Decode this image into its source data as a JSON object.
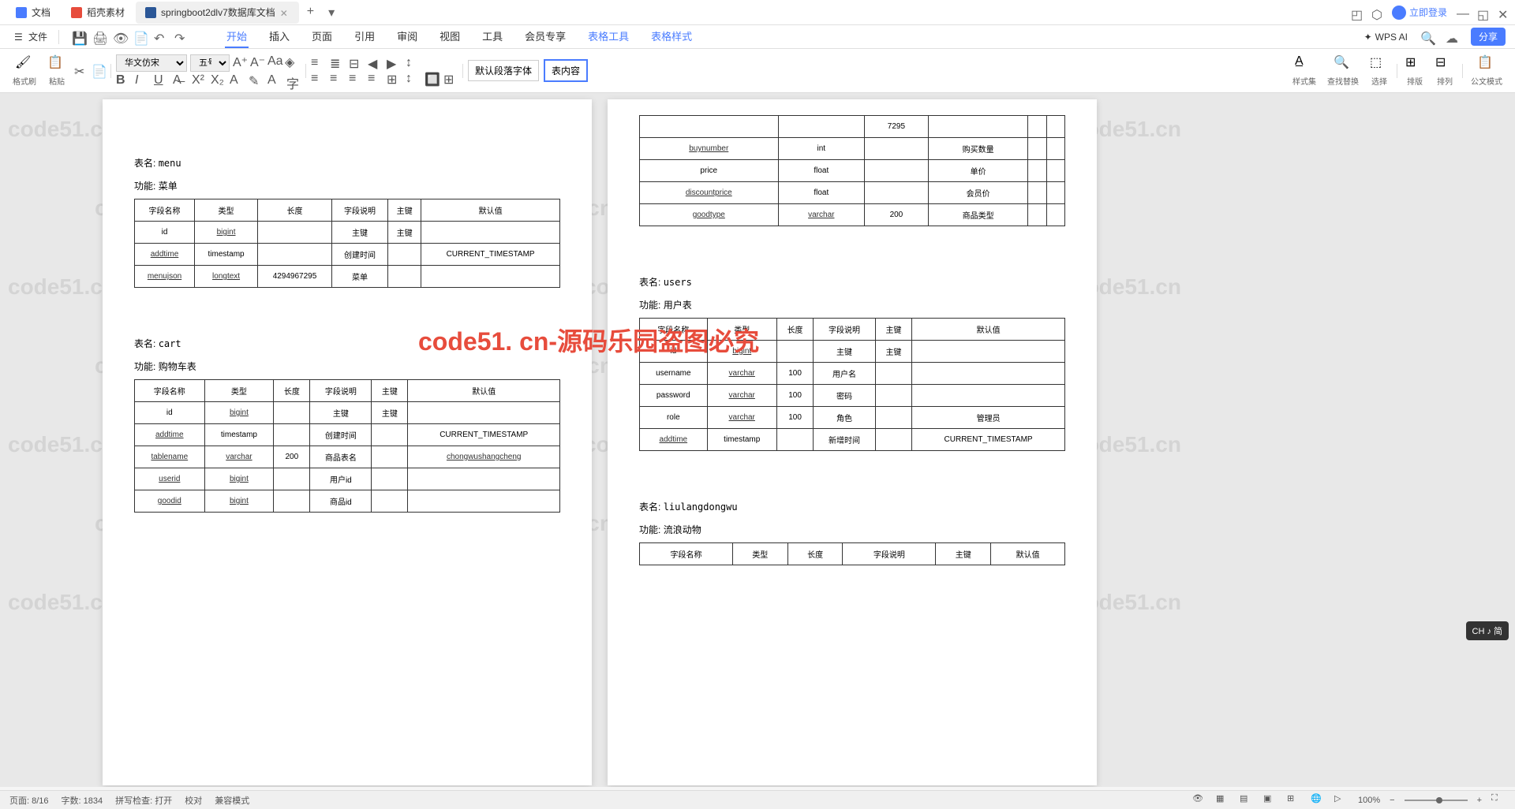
{
  "titlebar": {
    "tabs": [
      {
        "icon": "doc",
        "label": "文档"
      },
      {
        "icon": "red",
        "label": "稻壳素材"
      },
      {
        "icon": "word",
        "label": "springboot2dlv7数据库文档"
      }
    ],
    "login": "立即登录"
  },
  "menubar": {
    "file": "文件",
    "ribbon_tabs": [
      "开始",
      "插入",
      "页面",
      "引用",
      "审阅",
      "视图",
      "工具",
      "会员专享"
    ],
    "table_tabs": [
      "表格工具",
      "表格样式"
    ],
    "ai": "WPS AI",
    "share": "分享"
  },
  "ribbon": {
    "format_painter": "格式刷",
    "paste": "粘贴",
    "font": "华文仿宋",
    "size": "五号",
    "para_style_default": "默认段落字体",
    "para_style_content": "表内容",
    "styles": "样式集",
    "find_replace": "查找替换",
    "select": "选择",
    "arrange": "排版",
    "align": "排列",
    "doc_mode": "公文模式"
  },
  "doc": {
    "page_left": {
      "menu": {
        "title_label": "表名:",
        "title": "menu",
        "func_label": "功能:",
        "func": "菜单",
        "headers": [
          "字段名称",
          "类型",
          "长度",
          "字段说明",
          "主键",
          "默认值"
        ],
        "rows": [
          [
            "id",
            "bigint",
            "",
            "主键",
            "主键",
            ""
          ],
          [
            "addtime",
            "timestamp",
            "",
            "创建时间",
            "",
            "CURRENT_TIMESTAMP"
          ],
          [
            "menujson",
            "longtext",
            "4294967295",
            "菜单",
            "",
            ""
          ]
        ]
      },
      "cart": {
        "title_label": "表名:",
        "title": "cart",
        "func_label": "功能:",
        "func": "购物车表",
        "headers": [
          "字段名称",
          "类型",
          "长度",
          "字段说明",
          "主键",
          "默认值"
        ],
        "rows": [
          [
            "id",
            "bigint",
            "",
            "主键",
            "主键",
            ""
          ],
          [
            "addtime",
            "timestamp",
            "",
            "创建时间",
            "",
            "CURRENT_TIMESTAMP"
          ],
          [
            "tablename",
            "varchar",
            "200",
            "商品表名",
            "",
            "chongwushangcheng"
          ],
          [
            "userid",
            "bigint",
            "",
            "用户id",
            "",
            ""
          ],
          [
            "goodid",
            "bigint",
            "",
            "商品id",
            "",
            ""
          ]
        ]
      }
    },
    "page_right": {
      "top_rows": [
        [
          "",
          "",
          "7295",
          "",
          "",
          ""
        ],
        [
          "buynumber",
          "int",
          "",
          "购买数量",
          "",
          ""
        ],
        [
          "price",
          "float",
          "",
          "单价",
          "",
          ""
        ],
        [
          "discountprice",
          "float",
          "",
          "会员价",
          "",
          ""
        ],
        [
          "goodtype",
          "varchar",
          "200",
          "商品类型",
          "",
          ""
        ]
      ],
      "users": {
        "title_label": "表名:",
        "title": "users",
        "func_label": "功能:",
        "func": "用户表",
        "headers": [
          "字段名称",
          "类型",
          "长度",
          "字段说明",
          "主键",
          "默认值"
        ],
        "rows": [
          [
            "id",
            "bigint",
            "",
            "主键",
            "主键",
            ""
          ],
          [
            "username",
            "varchar",
            "100",
            "用户名",
            "",
            ""
          ],
          [
            "password",
            "varchar",
            "100",
            "密码",
            "",
            ""
          ],
          [
            "role",
            "varchar",
            "100",
            "角色",
            "",
            "管理员"
          ],
          [
            "addtime",
            "timestamp",
            "",
            "新增时间",
            "",
            "CURRENT_TIMESTAMP"
          ]
        ]
      },
      "liulang": {
        "title_label": "表名:",
        "title": "liulangdongwu",
        "func_label": "功能:",
        "func": "流浪动物",
        "headers": [
          "字段名称",
          "类型",
          "长度",
          "字段说明",
          "主键",
          "默认值"
        ]
      }
    }
  },
  "statusbar": {
    "page": "页面: 8/16",
    "words": "字数: 1834",
    "spell": "拼写检查: 打开",
    "proof": "校对",
    "compat": "兼容模式",
    "zoom": "100%"
  },
  "watermark_text": "code51.cn",
  "watermark_red": "code51. cn-源码乐园盗图必究",
  "lang_badge": "CH ♪ 简"
}
